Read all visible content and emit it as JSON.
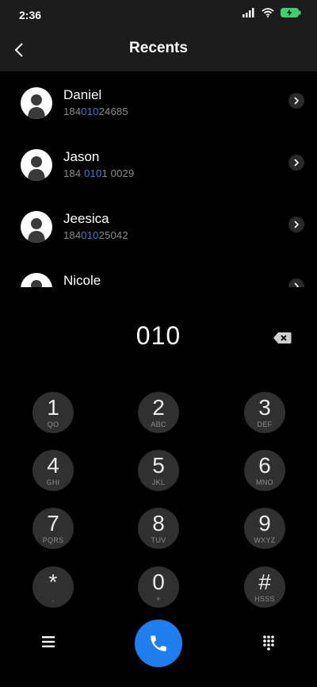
{
  "status": {
    "time": "2:36"
  },
  "header": {
    "title": "Recents"
  },
  "recents": [
    {
      "name": "Daniel",
      "number_pre": "184",
      "number_hl": "010",
      "number_post": "24685"
    },
    {
      "name": "Jason",
      "number_pre": "184 ",
      "number_hl": "010",
      "number_post": "1 0029"
    },
    {
      "name": "Jeesica",
      "number_pre": "184",
      "number_hl": "010",
      "number_post": "25042"
    },
    {
      "name": "Nicole",
      "number_pre": "",
      "number_hl": "",
      "number_post": ""
    }
  ],
  "dialer": {
    "input": "010",
    "keys": [
      {
        "digit": "1",
        "letters": "QO"
      },
      {
        "digit": "2",
        "letters": "ABC"
      },
      {
        "digit": "3",
        "letters": "DEF"
      },
      {
        "digit": "4",
        "letters": "GHI"
      },
      {
        "digit": "5",
        "letters": "JKL"
      },
      {
        "digit": "6",
        "letters": "MNO"
      },
      {
        "digit": "7",
        "letters": "PQRS"
      },
      {
        "digit": "8",
        "letters": "TUV"
      },
      {
        "digit": "9",
        "letters": "WXYZ"
      },
      {
        "digit": "*",
        "letters": ","
      },
      {
        "digit": "0",
        "letters": "+"
      },
      {
        "digit": "#",
        "letters": "HSSS"
      }
    ]
  },
  "colors": {
    "accent": "#1e7ef0",
    "highlight": "#3a7bd5",
    "background": "#000000"
  }
}
